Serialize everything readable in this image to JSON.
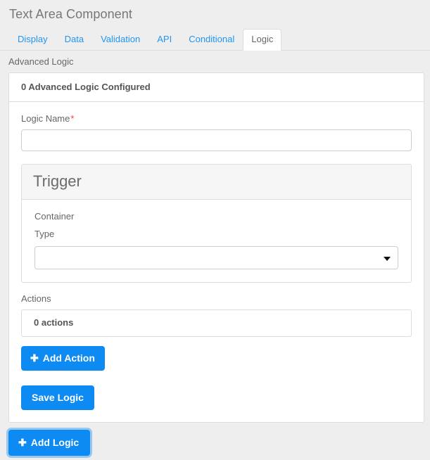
{
  "header": {
    "title": "Text Area Component"
  },
  "tabs": [
    {
      "label": "Display",
      "active": false
    },
    {
      "label": "Data",
      "active": false
    },
    {
      "label": "Validation",
      "active": false
    },
    {
      "label": "API",
      "active": false
    },
    {
      "label": "Conditional",
      "active": false
    },
    {
      "label": "Logic",
      "active": true
    }
  ],
  "section": {
    "label": "Advanced Logic"
  },
  "logic_card": {
    "header": "0 Advanced Logic Configured",
    "logic_name": {
      "label": "Logic Name",
      "required_marker": "*",
      "value": "",
      "placeholder": ""
    },
    "trigger": {
      "title": "Trigger",
      "container_label": "Container",
      "type_label": "Type",
      "type_value": "",
      "caret_icon": "chevron-down-icon"
    },
    "actions": {
      "label": "Actions",
      "count_text": "0 actions",
      "add_action_button": "Add Action",
      "add_action_icon": "plus-icon"
    },
    "save_logic_button": "Save Logic"
  },
  "footer": {
    "add_logic_button": "Add Logic",
    "add_logic_icon": "plus-icon"
  },
  "colors": {
    "accent": "#0d8bf2",
    "link": "#2196f3",
    "required": "#e8453c",
    "page_background": "#eeeeee",
    "panel_background": "#ffffff",
    "panel_header_background": "#f6f6f6",
    "border": "#dddddd"
  }
}
